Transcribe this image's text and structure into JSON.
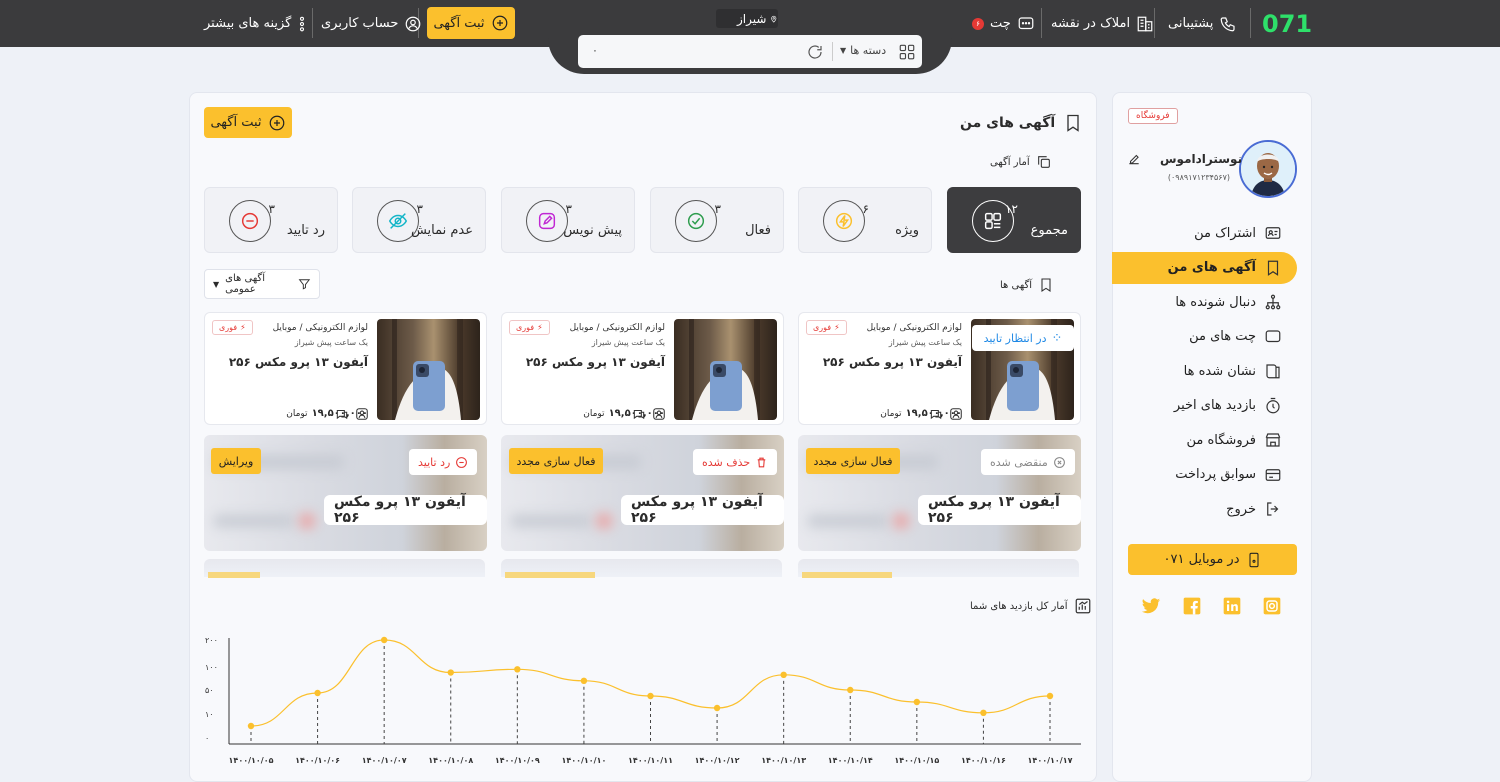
{
  "header": {
    "logo": "071",
    "support": "پشتیبانی",
    "map_listings": "املاک در نقشه",
    "chat": "چت",
    "chat_count": "۶",
    "city": "شیراز",
    "post_ad": "ثبت آگهی",
    "account": "حساب کاربری",
    "more_options": "گزینه های بیشتر",
    "search": {
      "category": "دسته ها",
      "value": "۰"
    }
  },
  "sidebar": {
    "store_tag": "فروشگاه",
    "user_name": "نوستراداموس",
    "user_phone": "(۰۹۸۹۱۷۱۲۳۴۵۶۷)",
    "items": [
      {
        "label": "اشتراک من",
        "icon": "id-card-icon"
      },
      {
        "label": "آگهی های من",
        "icon": "bookmark-icon"
      },
      {
        "label": "دنبال شونده ها",
        "icon": "hierarchy-icon"
      },
      {
        "label": "چت های من",
        "icon": "chat-icon"
      },
      {
        "label": "نشان شده ها",
        "icon": "book-icon"
      },
      {
        "label": "بازدید های اخیر",
        "icon": "timer-icon"
      },
      {
        "label": "فروشگاه من",
        "icon": "store-icon"
      },
      {
        "label": "سوابق پرداخت",
        "icon": "receipt-icon"
      },
      {
        "label": "خروج",
        "icon": "logout-icon"
      }
    ],
    "mobile_button": "۰۷۱ در موبایل",
    "socials": [
      "twitter-icon",
      "facebook-icon",
      "linkedin-icon",
      "instagram-icon"
    ]
  },
  "main": {
    "title": "آگهی های من",
    "post_ad": "ثبت آگهی",
    "stats_title": "آمار آگهی",
    "stats": [
      {
        "label": "مجموع",
        "value": "۱۲",
        "icon": "grid-icon"
      },
      {
        "label": "ویژه",
        "value": "۶",
        "icon": "lightning-icon"
      },
      {
        "label": "فعال",
        "value": "۳",
        "icon": "check-icon"
      },
      {
        "label": "پیش نویس",
        "value": "۳",
        "icon": "edit-icon"
      },
      {
        "label": "عدم نمایش",
        "value": "۳",
        "icon": "eye-off-icon"
      },
      {
        "label": "رد تایید",
        "value": "۳",
        "icon": "minus-icon"
      }
    ],
    "ads_title": "آگهی ها",
    "filter": "آگهی های عمومی",
    "cards": [
      {
        "category": "لوازم الکترونیکی / موبایل",
        "time": "یک ساعت پیش شیراز",
        "title": "آیفون ۱۳ پرو مکس ۲۵۶",
        "price": "۱۹,۵۰۰,۰۰۰",
        "currency": "تومان",
        "badge": "فوری",
        "status": "در انتظار تایید"
      },
      {
        "category": "لوازم الکترونیکی / موبایل",
        "time": "یک ساعت پیش شیراز",
        "title": "آیفون ۱۳ پرو مکس ۲۵۶",
        "price": "۱۹,۵۰۰,۰۰۰",
        "currency": "تومان",
        "badge": "فوری"
      },
      {
        "category": "لوازم الکترونیکی / موبایل",
        "time": "یک ساعت پیش شیراز",
        "title": "آیفون ۱۳ پرو مکس ۲۵۶",
        "price": "۱۹,۵۰۰,۰۰۰",
        "currency": "تومان",
        "badge": "فوری"
      }
    ],
    "blurred": [
      {
        "status": "منقضی شده",
        "action": "فعال سازی مجدد",
        "title": "آیفون ۱۳ پرو مکس ۲۵۶"
      },
      {
        "status": "حذف شده",
        "action": "فعال سازی مجدد",
        "title": "آیفون ۱۳ پرو مکس ۲۵۶"
      },
      {
        "status": "رد تایید",
        "action": "ویرایش",
        "title": "آیفون ۱۳ پرو مکس ۲۵۶"
      }
    ],
    "chart_title": "آمار کل بازدید های شما"
  },
  "chart_data": {
    "type": "line",
    "title": "آمار کل بازدید های شما",
    "x": [
      "۱۴۰۰/۱۰/۰۵",
      "۱۴۰۰/۱۰/۰۶",
      "۱۴۰۰/۱۰/۰۷",
      "۱۴۰۰/۱۰/۰۸",
      "۱۴۰۰/۱۰/۰۹",
      "۱۴۰۰/۱۰/۱۰",
      "۱۴۰۰/۱۰/۱۱",
      "۱۴۰۰/۱۰/۱۲",
      "۱۴۰۰/۱۰/۱۳",
      "۱۴۰۰/۱۰/۱۴",
      "۱۴۰۰/۱۰/۱۵",
      "۱۴۰۰/۱۰/۱۶",
      "۱۴۰۰/۱۰/۱۷"
    ],
    "y_ticks": [
      "۲۰۰",
      "۱۰۰",
      "۵۰",
      "۱۰",
      "۰"
    ],
    "y_tick_values": [
      200,
      100,
      50,
      10,
      0
    ],
    "values": [
      5,
      45,
      200,
      88,
      95,
      70,
      40,
      20,
      83,
      50,
      30,
      12,
      40
    ],
    "color": "#fbc02d",
    "grid": false
  }
}
